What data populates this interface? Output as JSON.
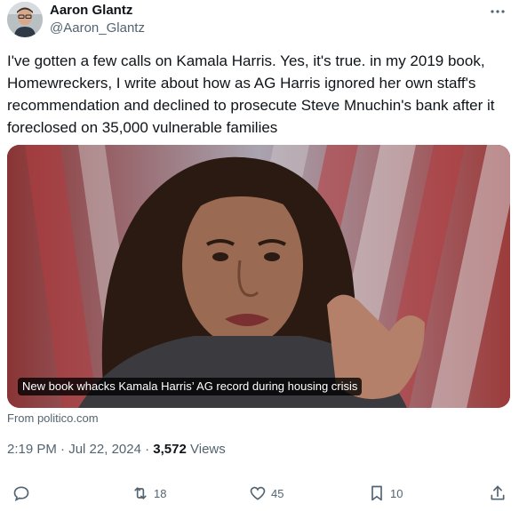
{
  "author": {
    "display_name": "Aaron Glantz",
    "handle": "@Aaron_Glantz"
  },
  "more_icon": "more-horizontal-icon",
  "tweet": {
    "text": "I've gotten a few calls on Kamala Harris. Yes, it's true. in my 2019 book, Homewreckers, I write about how as AG Harris ignored her own staff's recommendation and declined to prosecute Steve Mnuchin's bank after it foreclosed on 35,000 vulnerable families"
  },
  "link_card": {
    "caption": "New book whacks Kamala Harris’ AG record during housing crisis",
    "source": "From politico.com"
  },
  "meta": {
    "time": "2:19 PM",
    "separator": "·",
    "date": "Jul 22, 2024",
    "views_count": "3,572",
    "views_label": "Views"
  },
  "actions": {
    "reply": {
      "icon": "reply-icon",
      "count": ""
    },
    "repost": {
      "icon": "repost-icon",
      "count": "18"
    },
    "like": {
      "icon": "heart-icon",
      "count": "45"
    },
    "bookmark": {
      "icon": "bookmark-icon",
      "count": "10"
    },
    "share": {
      "icon": "share-icon",
      "count": ""
    }
  },
  "colors": {
    "text_primary": "#0f1419",
    "text_secondary": "#536471",
    "caption_bg": "#000000"
  }
}
